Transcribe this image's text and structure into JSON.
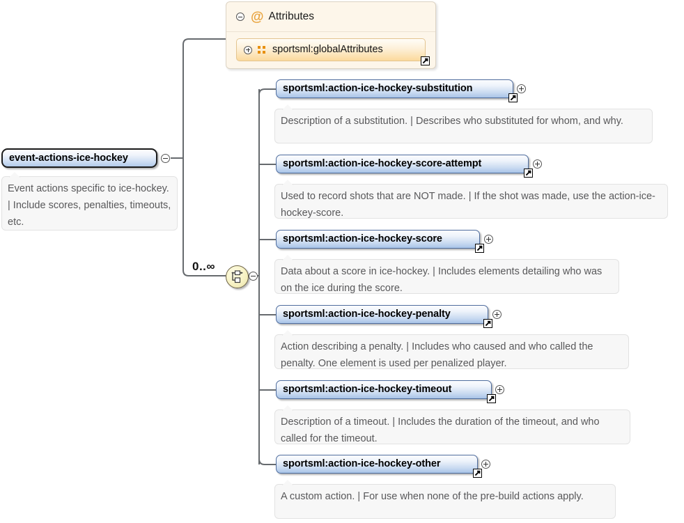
{
  "diagram": {
    "type": "xml-schema-element-diagram",
    "accent_blue": "#a9c4e8",
    "accent_orange": "#e8900f",
    "compositor": {
      "kind": "choice",
      "icon": "choice-compositor-icon",
      "cardinality": "0..∞",
      "toggle": "collapse-icon"
    }
  },
  "root": {
    "name": "event-actions-ice-hockey",
    "toggle": "collapse-icon",
    "documentation": "Event actions specific to ice-hockey. | Include scores, penalties, timeouts, etc."
  },
  "attributes_panel": {
    "title": "Attributes",
    "at_symbol": "@",
    "toggle": "collapse-icon",
    "rows": [
      {
        "name": "sportsml:globalAttributes",
        "toggle": "expand-icon",
        "icon": "attribute-group-icon",
        "link": "goto-definition-icon"
      }
    ]
  },
  "children": [
    {
      "name": "sportsml:action-ice-hockey-substitution",
      "toggle": "expand-icon",
      "link": "goto-definition-icon",
      "documentation": "Description of a substitution. | Describes who substituted for whom, and why."
    },
    {
      "name": "sportsml:action-ice-hockey-score-attempt",
      "toggle": "expand-icon",
      "link": "goto-definition-icon",
      "documentation": "Used to record shots that are NOT made. | If the shot was made, use the action-ice-hockey-score."
    },
    {
      "name": "sportsml:action-ice-hockey-score",
      "toggle": "expand-icon",
      "link": "goto-definition-icon",
      "documentation": "Data about a score in ice-hockey. | Includes elements detailing who was on the ice during the score."
    },
    {
      "name": "sportsml:action-ice-hockey-penalty",
      "toggle": "expand-icon",
      "link": "goto-definition-icon",
      "documentation": "Action describing a penalty. | Includes who caused and who called the penalty. One element is used per penalized player."
    },
    {
      "name": "sportsml:action-ice-hockey-timeout",
      "toggle": "expand-icon",
      "link": "goto-definition-icon",
      "documentation": "Description of a timeout. | Includes the duration of the timeout, and who called for the timeout."
    },
    {
      "name": "sportsml:action-ice-hockey-other",
      "toggle": "expand-icon",
      "link": "goto-definition-icon",
      "documentation": "A custom action. | For use when none of the pre-build actions apply."
    }
  ]
}
